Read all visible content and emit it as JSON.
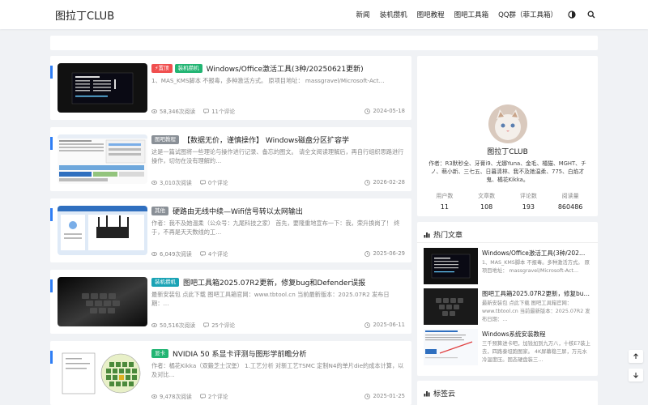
{
  "header": {
    "logo": "图拉丁CLUB",
    "nav": [
      "新闻",
      "装机攒机",
      "图吧教程",
      "图吧工具箱",
      "QQ群（菲工具箱）"
    ],
    "theme_icon": "half-moon-icon",
    "search_icon": "search-icon"
  },
  "posts": [
    {
      "tags": [
        {
          "label": "⚡置顶",
          "color": "red"
        },
        {
          "label": "装机攒机",
          "color": "green"
        }
      ],
      "title": "Windows/Office激活工具(3种/20250621更新)",
      "excerpt": "1、MAS_KMS脚本 不报毒，多种激活方式。 原项目地址： massgravel/Microsoft-Act…",
      "views": "58,346次阅读",
      "comments": "11个评论",
      "date": "2024-05-18"
    },
    {
      "tags": [
        {
          "label": "图吧教程",
          "color": "gray"
        }
      ],
      "title": "【数据无价，谨慎操作】 Windows磁盘分区扩容学",
      "excerpt": "这是一篇试图将一些理论与操作进行记录、备忘的图文。 请全文阅读理解后，再自行组织思路进行操作，切勿在没有理解的…",
      "views": "3,010次阅读",
      "comments": "0个评论",
      "date": "2026-02-28"
    },
    {
      "tags": [
        {
          "label": "其他",
          "color": "gray"
        }
      ],
      "title": "硬路由无线中续—Wifi信号转以太网输出",
      "excerpt": "作者：我不及她温柔（公众号：九尾科技之家） 首先，要隆重地宣布一下：我，荣升换岗了！ 终于，不再是天天数线的工…",
      "views": "6,049次阅读",
      "comments": "4个评论",
      "date": "2025-06-29"
    },
    {
      "tags": [
        {
          "label": "装机攒机",
          "color": "teal"
        }
      ],
      "title": "图吧工具箱2025.07R2更新，修复bug和Defender误报",
      "excerpt": "最新安装包 点此下载 图吧工具箱官网：www.tbtool.cn 当前最新版本：2025.07R2 发布日期：…",
      "views": "50,516次阅读",
      "comments": "25个评论",
      "date": "2025-06-11"
    },
    {
      "tags": [
        {
          "label": "显卡",
          "color": "green"
        }
      ],
      "title": "NVIDIA 50 系显卡评测与图形学前瞻分析",
      "excerpt": "作者：橘花Kikka（双鍛芝士汉堡） 1.工艺分析 对新工艺TSMC 定制N4的单片die的成本计算，以及对比…",
      "views": "9,478次阅读",
      "comments": "2个评论",
      "date": "2025-01-25"
    }
  ],
  "profile": {
    "name": "图拉丁CLUB",
    "desc": "作者：R3默秒全、牙膏i9、尤娜Yuna、金毛、橘猫、MGHT、チノ、萌小新、三七五、日暮清林、我不及她温柔、775、白焰才鬼、橘花Kikka。",
    "stats": [
      {
        "label": "用户数",
        "value": "11"
      },
      {
        "label": "文章数",
        "value": "108"
      },
      {
        "label": "评论数",
        "value": "193"
      },
      {
        "label": "阅读量",
        "value": "860486"
      }
    ]
  },
  "hot": {
    "title": "热门文章",
    "items": [
      {
        "title": "Windows/Office激活工具(3种/202…",
        "excerpt": "1、MAS_KMS脚本 不报毒。多种激活方式。 原项目地址： massgravel/Microsoft-Act…"
      },
      {
        "title": "图吧工具箱2025.07R2更新，修复bu…",
        "excerpt": "最新安装包 点此下载 图吧工具箱官网：www.tbtool.cn 当前最新版本：2025.07R2 发布日期：…"
      },
      {
        "title": "Windows系统安装教程",
        "excerpt": "三千预算进卡吧，加钱加到九万八，十核E7装上去，四路泰坦跑图家。 4K屏幕稳三屏，万元水冷温度压。固态硬盘装三…"
      }
    ]
  },
  "tagcloud": {
    "title": "标签云"
  },
  "fab": {
    "up_icon": "arrow-up-icon",
    "down_icon": "arrow-down-icon"
  }
}
